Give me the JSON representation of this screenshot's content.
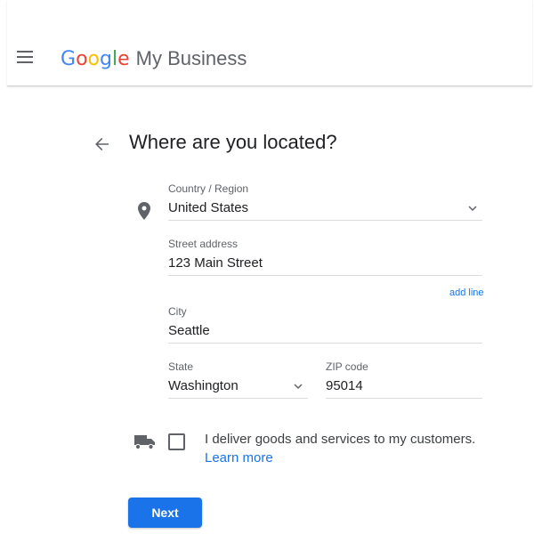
{
  "header": {
    "logo_letters": [
      {
        "char": "G",
        "color": "#4285F4"
      },
      {
        "char": "o",
        "color": "#EA4335"
      },
      {
        "char": "o",
        "color": "#FBBC05"
      },
      {
        "char": "g",
        "color": "#4285F4"
      },
      {
        "char": "l",
        "color": "#34A853"
      },
      {
        "char": "e",
        "color": "#EA4335"
      }
    ],
    "product_name": "My Business",
    "menu_icon": "hamburger-menu-icon"
  },
  "page": {
    "title": "Where are you located?",
    "back_icon": "arrow-left-icon"
  },
  "form": {
    "location_icon": "map-pin-icon",
    "country": {
      "label": "Country / Region",
      "value": "United States"
    },
    "street": {
      "label": "Street address",
      "value": "123 Main Street"
    },
    "add_line_label": "add line",
    "city": {
      "label": "City",
      "value": "Seattle"
    },
    "state": {
      "label": "State",
      "value": "Washington"
    },
    "zip": {
      "label": "ZIP code",
      "value": "95014"
    }
  },
  "delivery": {
    "truck_icon": "delivery-truck-icon",
    "checked": false,
    "text": "I deliver goods and services to my customers.",
    "learn_more": "Learn more"
  },
  "actions": {
    "next_label": "Next"
  },
  "colors": {
    "accent": "#1a73e8",
    "text_primary": "#202124",
    "text_secondary": "#5f6368",
    "divider": "#dadce0"
  }
}
